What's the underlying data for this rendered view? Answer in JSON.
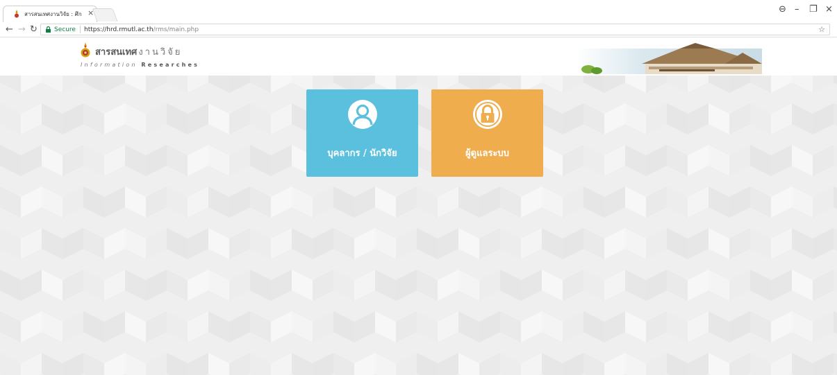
{
  "browser": {
    "tab_title": "สารสนเทศงานวิจัย : ศึกษาระ",
    "close_tab": "×",
    "secure_label": "Secure",
    "url_host": "https://hrd.rmutl.ac.th",
    "url_path": "/rms/main.php",
    "window_controls": [
      "⊖",
      "–",
      "❐",
      "×"
    ]
  },
  "header": {
    "brand_bold": "สารสนเทศ",
    "brand_spaced": "งานวิจัย",
    "subtitle_italic": "Information",
    "subtitle_bold": "Researches"
  },
  "tiles": [
    {
      "label": "บุคลากร / นักวิจัย",
      "color": "#5bc0de",
      "icon": "user-icon"
    },
    {
      "label": "ผู้ดูแลระบบ",
      "color": "#f0ad4e",
      "icon": "lock-icon"
    }
  ]
}
